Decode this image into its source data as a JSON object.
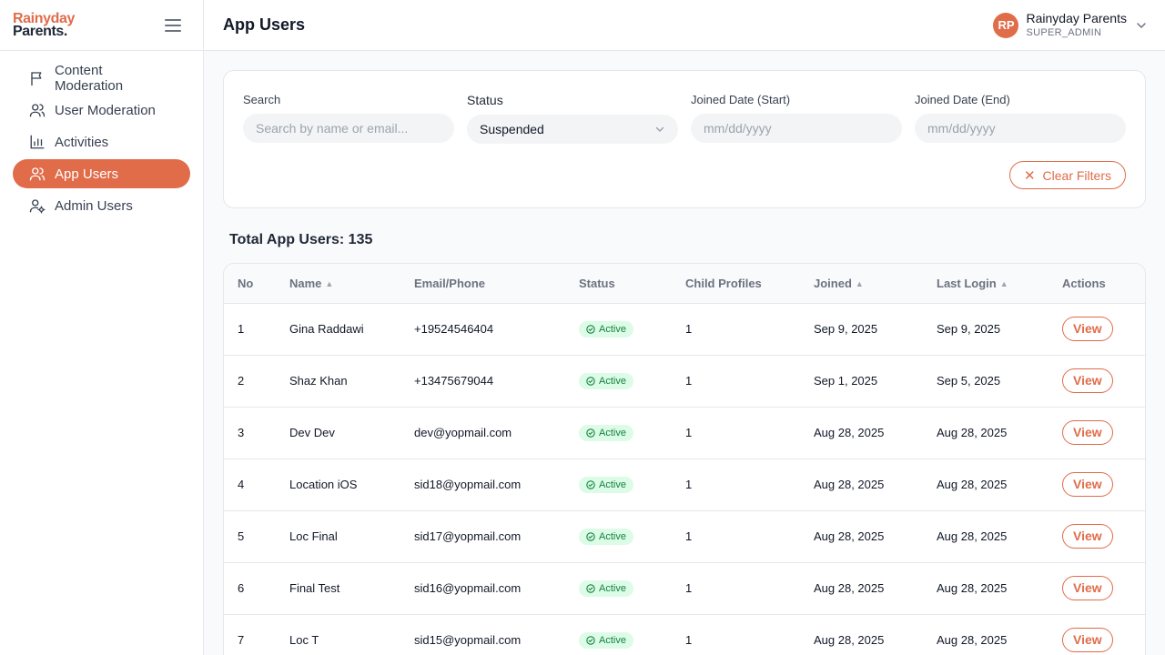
{
  "brand": {
    "line1": "Rainyday",
    "line2": "Parents."
  },
  "sidebar": {
    "items": [
      {
        "label": "Content Moderation",
        "icon": "flag-icon"
      },
      {
        "label": "User Moderation",
        "icon": "users-icon"
      },
      {
        "label": "Activities",
        "icon": "bar-chart-icon"
      },
      {
        "label": "App Users",
        "icon": "users-icon",
        "active": true
      },
      {
        "label": "Admin Users",
        "icon": "user-cog-icon"
      }
    ]
  },
  "header": {
    "title": "App Users",
    "user": {
      "initials": "RP",
      "name": "Rainyday Parents",
      "role": "SUPER_ADMIN"
    }
  },
  "filters": {
    "search_label": "Search",
    "search_placeholder": "Search by name or email...",
    "status_label": "Status",
    "status_value": "Suspended",
    "start_label": "Joined Date (Start)",
    "start_placeholder": "mm/dd/yyyy",
    "end_label": "Joined Date (End)",
    "end_placeholder": "mm/dd/yyyy",
    "clear_label": "Clear Filters"
  },
  "total_label": "Total App Users: 135",
  "table": {
    "columns": [
      "No",
      "Name",
      "Email/Phone",
      "Status",
      "Child Profiles",
      "Joined",
      "Last Login",
      "Actions"
    ],
    "view_label": "View",
    "rows": [
      {
        "no": "1",
        "name": "Gina Raddawi",
        "contact": "+19524546404",
        "status": "Active",
        "children": "1",
        "joined": "Sep 9, 2025",
        "last_login": "Sep 9, 2025"
      },
      {
        "no": "2",
        "name": "Shaz Khan",
        "contact": "+13475679044",
        "status": "Active",
        "children": "1",
        "joined": "Sep 1, 2025",
        "last_login": "Sep 5, 2025"
      },
      {
        "no": "3",
        "name": "Dev Dev",
        "contact": "dev@yopmail.com",
        "status": "Active",
        "children": "1",
        "joined": "Aug 28, 2025",
        "last_login": "Aug 28, 2025"
      },
      {
        "no": "4",
        "name": "Location iOS",
        "contact": "sid18@yopmail.com",
        "status": "Active",
        "children": "1",
        "joined": "Aug 28, 2025",
        "last_login": "Aug 28, 2025"
      },
      {
        "no": "5",
        "name": "Loc Final",
        "contact": "sid17@yopmail.com",
        "status": "Active",
        "children": "1",
        "joined": "Aug 28, 2025",
        "last_login": "Aug 28, 2025"
      },
      {
        "no": "6",
        "name": "Final Test",
        "contact": "sid16@yopmail.com",
        "status": "Active",
        "children": "1",
        "joined": "Aug 28, 2025",
        "last_login": "Aug 28, 2025"
      },
      {
        "no": "7",
        "name": "Loc T",
        "contact": "sid15@yopmail.com",
        "status": "Active",
        "children": "1",
        "joined": "Aug 28, 2025",
        "last_login": "Aug 28, 2025"
      }
    ]
  },
  "colors": {
    "accent": "#e06c4a",
    "active_badge_bg": "#dcfce7",
    "active_badge_text": "#15803d"
  }
}
